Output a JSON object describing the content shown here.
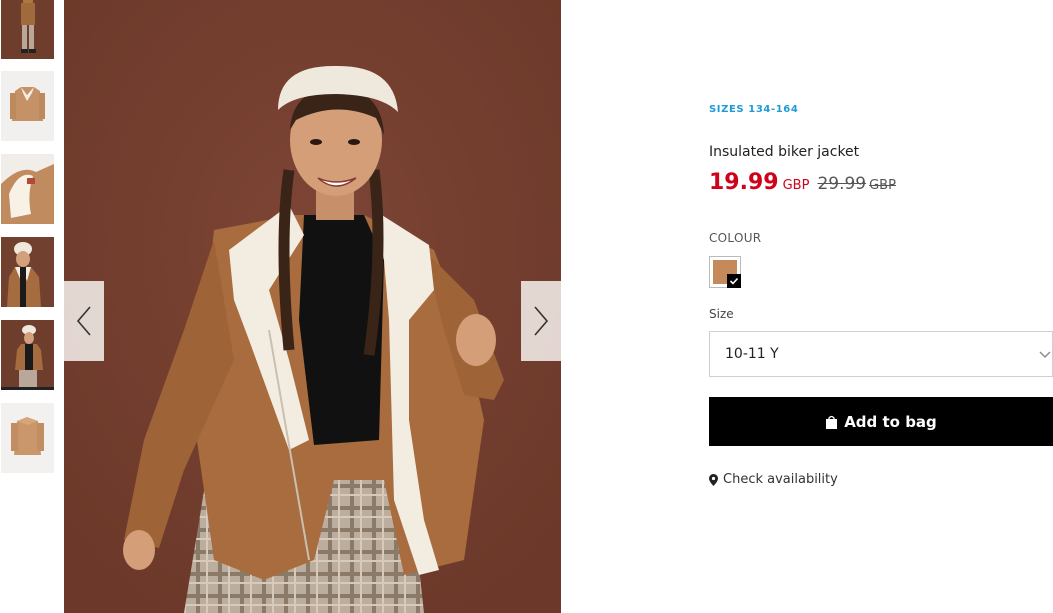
{
  "gallery": {
    "thumbnails": [
      {
        "kind": "model",
        "alt": ""
      },
      {
        "kind": "jacket-front",
        "alt": ""
      },
      {
        "kind": "jacket-collar",
        "alt": ""
      },
      {
        "kind": "model-closeup",
        "alt": ""
      },
      {
        "kind": "model-full",
        "alt": "",
        "active": true
      },
      {
        "kind": "jacket-back",
        "alt": ""
      }
    ],
    "prev_icon": "chevron-left-icon",
    "next_icon": "chevron-right-icon"
  },
  "product": {
    "sizes_tag": "SIZES 134-164",
    "name": "Insulated biker jacket",
    "price_now": "19.99",
    "price_now_currency": "GBP",
    "price_old": "29.99",
    "price_old_currency": "GBP",
    "colour_label": "COLOUR",
    "swatch_color": "#c48a5c",
    "size_label": "Size",
    "size_selected": "10-11 Y",
    "add_to_bag": "Add to bag",
    "check_availability": "Check availability"
  },
  "colors": {
    "sale_red": "#d0021b",
    "accent_blue": "#1e9bd7",
    "button_black": "#000000",
    "background_brown": "#7a4233"
  }
}
